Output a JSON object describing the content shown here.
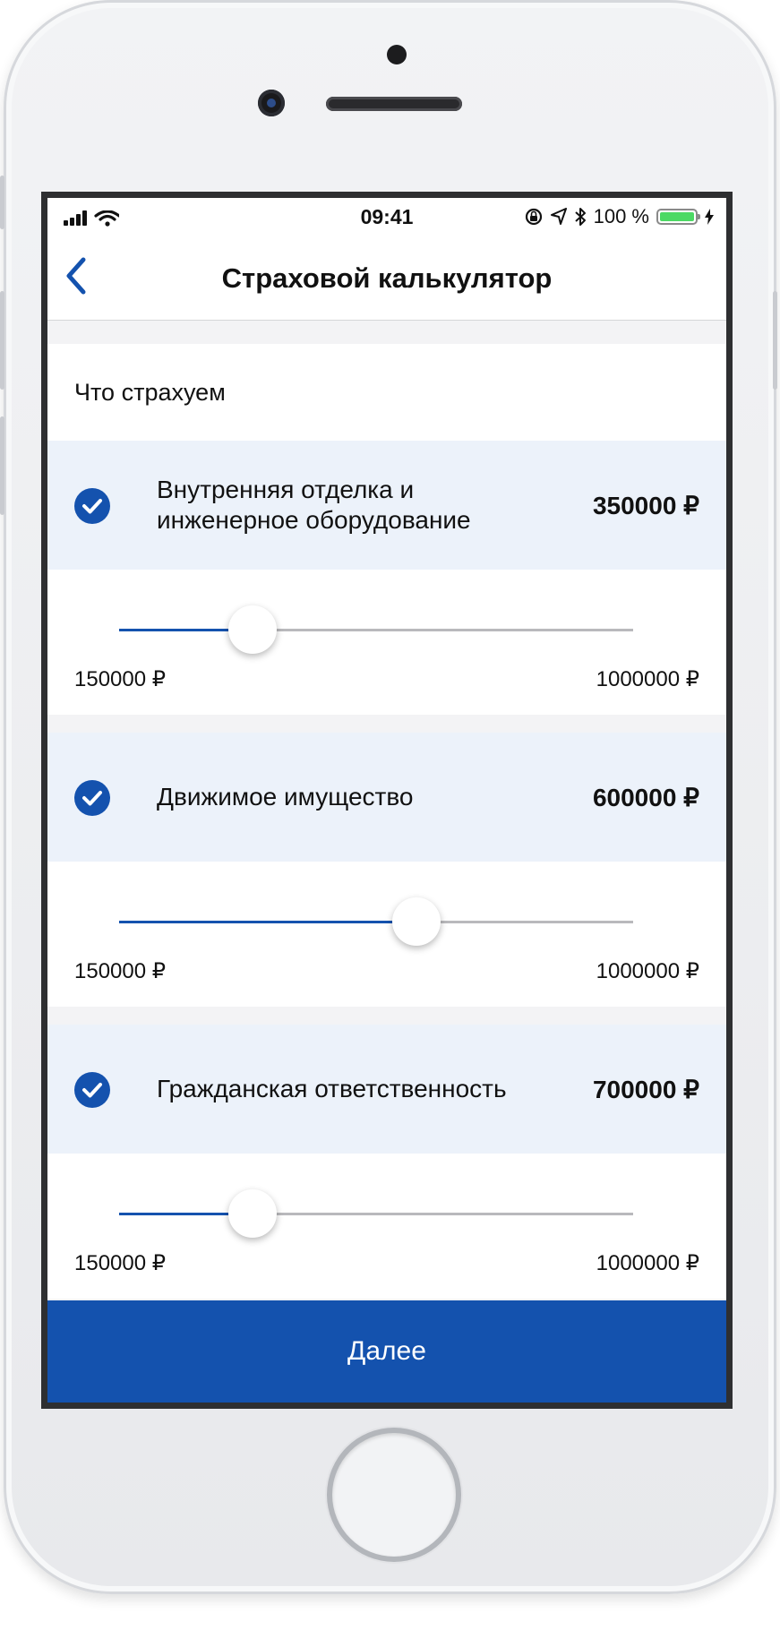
{
  "status": {
    "time": "09:41",
    "battery": "100 %"
  },
  "nav": {
    "title": "Страховой калькулятор"
  },
  "section_label": "Что страхуем",
  "items": [
    {
      "title": "Внутренняя отделка и инженерное оборудование",
      "price": "350000 ₽",
      "min": "150000 ₽",
      "max": "1000000 ₽",
      "fraction": 0.259,
      "checked": true
    },
    {
      "title": "Движимое имущество",
      "price": "600000 ₽",
      "min": "150000 ₽",
      "max": "1000000 ₽",
      "fraction": 0.579,
      "checked": true
    },
    {
      "title": "Гражданская ответственность",
      "price": "700000 ₽",
      "min": "150000 ₽",
      "max": "1000000 ₽",
      "fraction": 0.259,
      "checked": true
    }
  ],
  "next_button": "Далее",
  "colors": {
    "accent": "#1452ae",
    "item_bg": "#ecf2fa",
    "battery": "#4cd964"
  }
}
